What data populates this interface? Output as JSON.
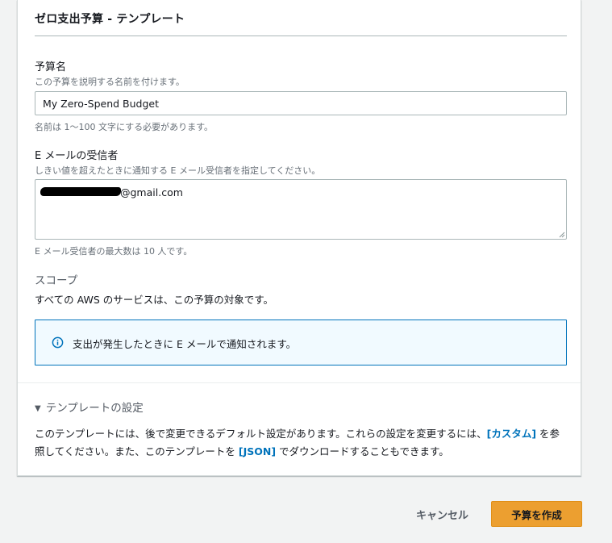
{
  "panel": {
    "title": "ゼロ支出予算 - テンプレート"
  },
  "budget_name": {
    "label": "予算名",
    "description": "この予算を説明する名前を付けます。",
    "value": "My Zero-Spend Budget",
    "constraint": "名前は 1～100 文字にする必要があります。"
  },
  "email_recipients": {
    "label": "E メールの受信者",
    "description": "しきい値を超えたときに通知する E メール受信者を指定してください。",
    "value_visible": "@gmail.com",
    "constraint": "E メール受信者の最大数は 10 人です。"
  },
  "scope": {
    "label": "スコープ",
    "value": "すべての AWS のサービスは、この予算の対象です。"
  },
  "info": {
    "icon": "info-icon",
    "text": "支出が発生したときに E メールで通知されます。"
  },
  "template_settings": {
    "caret": "▼",
    "label": "テンプレートの設定",
    "desc_part1": "このテンプレートには、後で変更できるデフォルト設定があります。これらの設定を変更するには、",
    "link_custom": "[カスタム]",
    "desc_part2": " を参照してください。また、このテンプレートを ",
    "link_json": "[JSON]",
    "desc_part3": " でダウンロードすることもできます。"
  },
  "actions": {
    "cancel_label": "キャンセル",
    "create_label": "予算を作成"
  },
  "colors": {
    "primary_button": "#ec9f30",
    "link": "#0073bb",
    "info_border": "#0073bb",
    "info_background": "#f1faff"
  }
}
